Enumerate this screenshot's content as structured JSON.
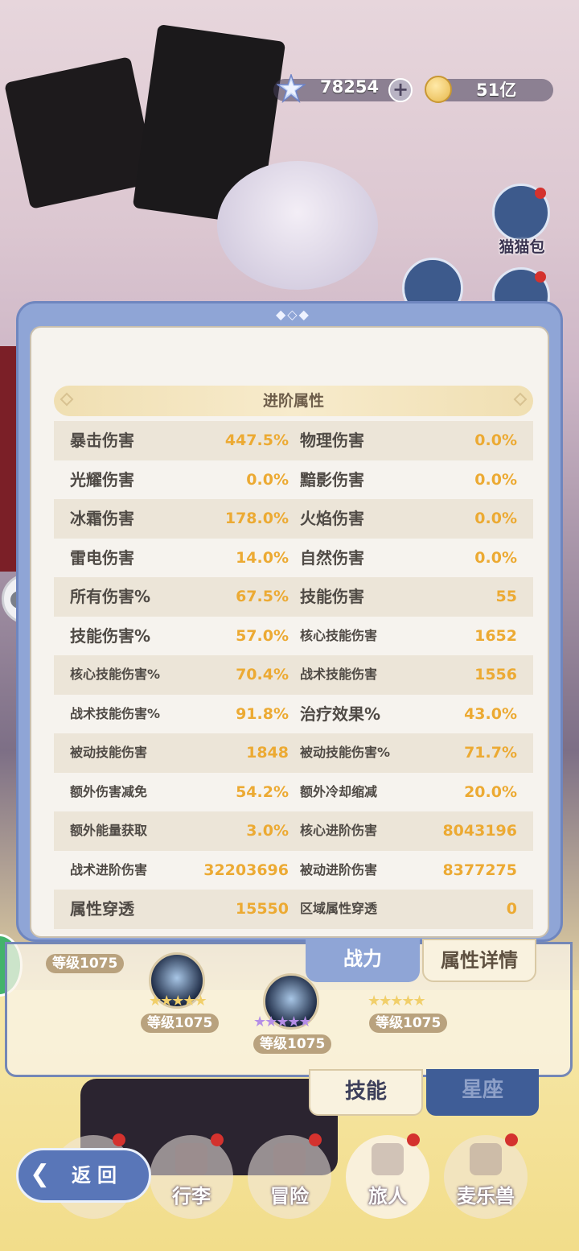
{
  "currency": {
    "gems": "78254",
    "gold": "51亿"
  },
  "side": {
    "cat_bag_label": "猫猫包"
  },
  "panel": {
    "section_title": "进阶属性",
    "rows": [
      {
        "l1": "暴击伤害",
        "v1": "447.5%",
        "l2": "物理伤害",
        "v2": "0.0%"
      },
      {
        "l1": "光耀伤害",
        "v1": "0.0%",
        "l2": "黯影伤害",
        "v2": "0.0%"
      },
      {
        "l1": "冰霜伤害",
        "v1": "178.0%",
        "l2": "火焰伤害",
        "v2": "0.0%"
      },
      {
        "l1": "雷电伤害",
        "v1": "14.0%",
        "l2": "自然伤害",
        "v2": "0.0%"
      },
      {
        "l1": "所有伤害%",
        "v1": "67.5%",
        "l2": "技能伤害",
        "v2": "55"
      },
      {
        "l1": "技能伤害%",
        "v1": "57.0%",
        "l2": "核心技能伤害",
        "v2": "1652"
      },
      {
        "l1": "核心技能伤害%",
        "v1": "70.4%",
        "l2": "战术技能伤害",
        "v2": "1556"
      },
      {
        "l1": "战术技能伤害%",
        "v1": "91.8%",
        "l2": "治疗效果%",
        "v2": "43.0%"
      },
      {
        "l1": "被动技能伤害",
        "v1": "1848",
        "l2": "被动技能伤害%",
        "v2": "71.7%"
      },
      {
        "l1": "额外伤害减免",
        "v1": "54.2%",
        "l2": "额外冷却缩减",
        "v2": "20.0%"
      },
      {
        "l1": "额外能量获取",
        "v1": "3.0%",
        "l2": "核心进阶伤害",
        "v2": "8043196"
      },
      {
        "l1": "战术进阶伤害",
        "v1": "32203696",
        "l2": "被动进阶伤害",
        "v2": "8377275"
      },
      {
        "l1": "属性穿透",
        "v1": "15550",
        "l2": "区域属性穿透",
        "v2": "0"
      }
    ]
  },
  "tabs": {
    "power": "战力",
    "detail": "属性详情",
    "skill": "技能",
    "constellation": "星座"
  },
  "skills": {
    "level_label": "等级1075"
  },
  "nav": {
    "back": "返回",
    "luggage": "行李",
    "adventure": "冒险",
    "traveler": "旅人",
    "pet": "麦乐兽"
  },
  "colors": {
    "panel_blue": "#8fa5d6",
    "value_orange": "#ecaa33",
    "header_gold": "#f0dfb2"
  }
}
